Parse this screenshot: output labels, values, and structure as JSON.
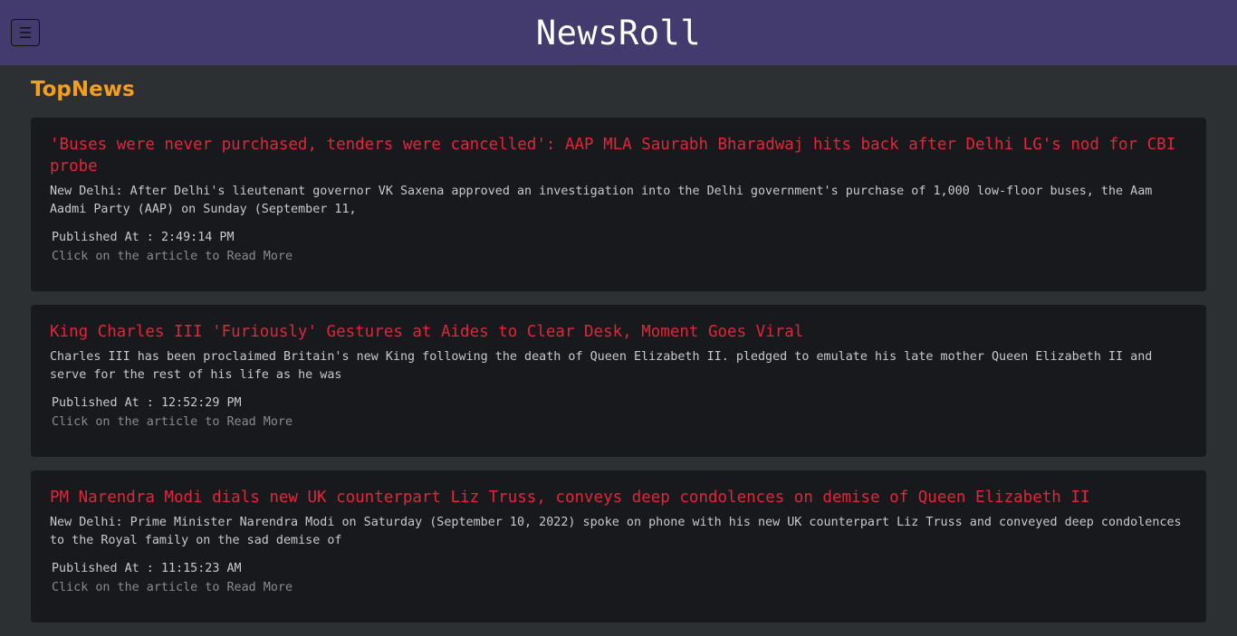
{
  "header": {
    "title": "NewsRoll",
    "menu_icon": "hamburger-menu-icon"
  },
  "section": {
    "title": "TopNews"
  },
  "articles": [
    {
      "title": "'Buses were never purchased, tenders were cancelled': AAP MLA Saurabh Bharadwaj hits back after Delhi LG's nod for CBI probe",
      "description": "New Delhi: After Delhi's lieutenant governor VK Saxena approved an investigation into the Delhi government's purchase of 1,000 low-floor buses, the Aam Aadmi Party (AAP) on Sunday (September 11,",
      "published_label": "Published At",
      "published_time": "2:49:14 PM",
      "read_more": "Click on the article to Read More"
    },
    {
      "title": "King Charles III 'Furiously' Gestures at Aides to Clear Desk, Moment Goes Viral",
      "description": "Charles III has been proclaimed Britain's new King following the death of Queen Elizabeth II. pledged to emulate his late mother Queen Elizabeth II and serve for the rest of his life as he was",
      "published_label": "Published At",
      "published_time": "12:52:29 PM",
      "read_more": "Click on the article to Read More"
    },
    {
      "title": "PM Narendra Modi dials new UK counterpart Liz Truss, conveys deep condolences on demise of Queen Elizabeth II",
      "description": "New Delhi: Prime Minister Narendra Modi on Saturday (September 10, 2022) spoke on phone with his new UK counterpart Liz Truss and conveyed deep condolences to the Royal family on the sad demise of",
      "published_label": "Published At",
      "published_time": "11:15:23 AM",
      "read_more": "Click on the article to Read More"
    }
  ],
  "colors": {
    "header_bg": "#433a6e",
    "page_bg": "#2d3033",
    "card_bg": "#18191c",
    "section_title": "#f59e1b",
    "article_title": "#e02638"
  }
}
